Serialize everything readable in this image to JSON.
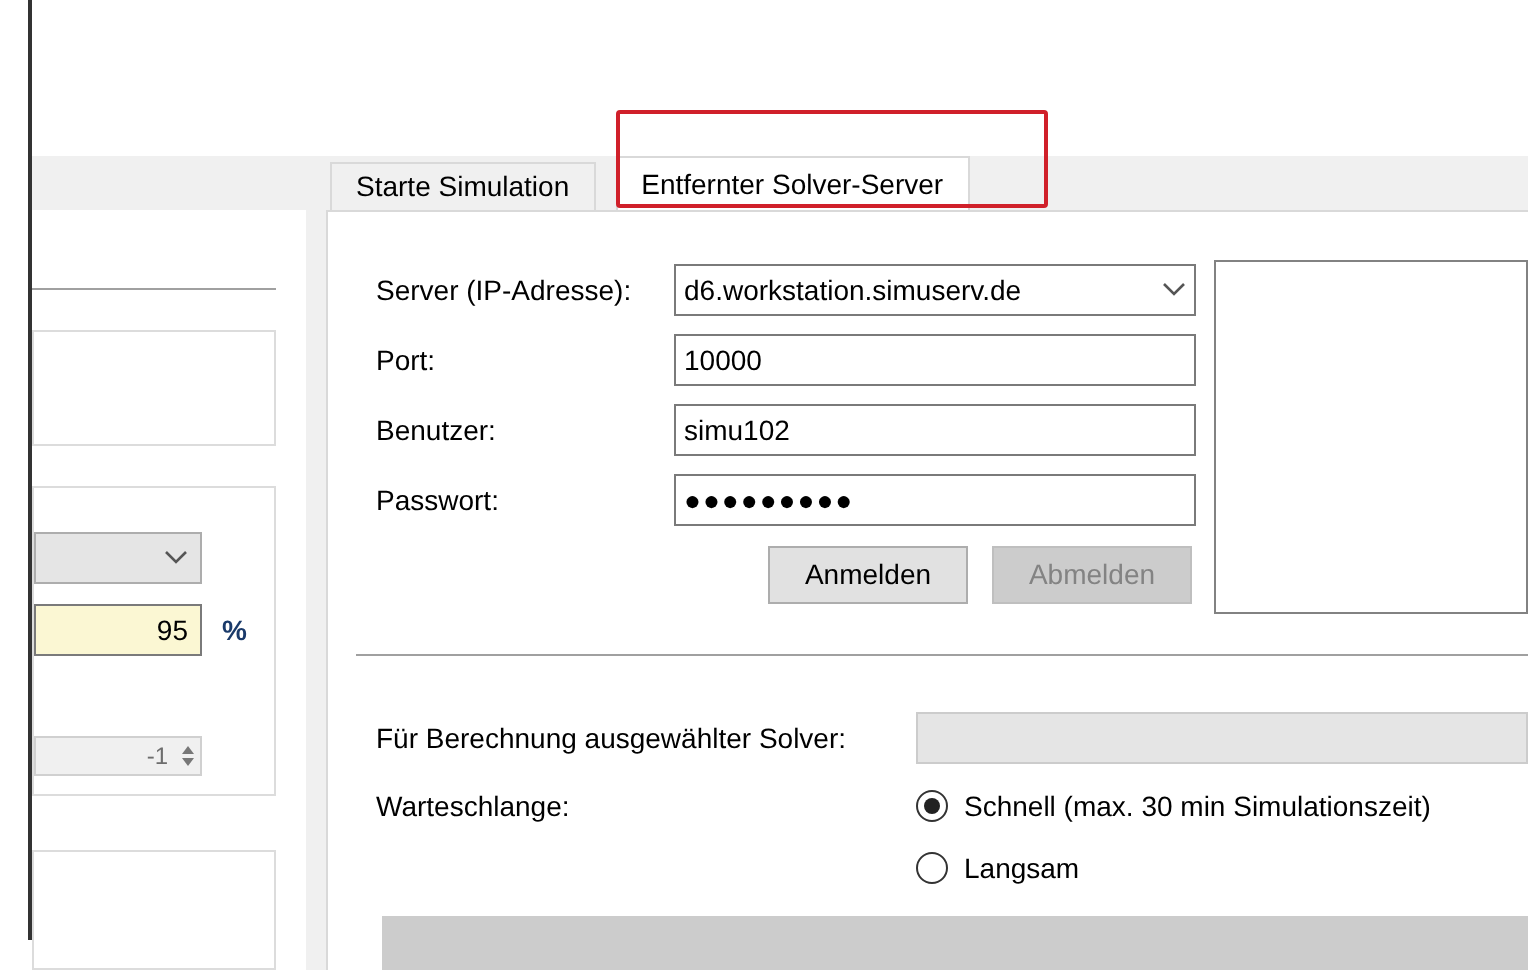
{
  "tabs": [
    {
      "label": "Starte Simulation",
      "selected": false
    },
    {
      "label": "Entfernter Solver-Server",
      "selected": true
    }
  ],
  "server": {
    "fields": [
      {
        "kind": "combo",
        "label": "Server (IP-Adresse):",
        "value": "d6.workstation.simuserv.de"
      },
      {
        "kind": "text",
        "label": "Port:",
        "value": "10000"
      },
      {
        "kind": "text",
        "label": "Benutzer:",
        "value": "simu102"
      },
      {
        "kind": "password",
        "label": "Passwort:",
        "value": "●●●●●●●●●"
      }
    ],
    "buttons": [
      {
        "label": "Anmelden",
        "disabled": false
      },
      {
        "label": "Abmelden",
        "disabled": true
      }
    ]
  },
  "solver": {
    "label": "Für Berechnung ausgewählter Solver:",
    "disabled": true
  },
  "queue": {
    "label": "Warteschlange:",
    "options": [
      {
        "label": "Schnell (max. 30 min Simulationszeit)",
        "selected": true
      },
      {
        "label": "Langsam",
        "selected": false
      }
    ]
  },
  "left_panel": {
    "percent": {
      "value": "95",
      "unit": "%"
    },
    "spinner": {
      "value": "-1",
      "disabled": true
    }
  }
}
